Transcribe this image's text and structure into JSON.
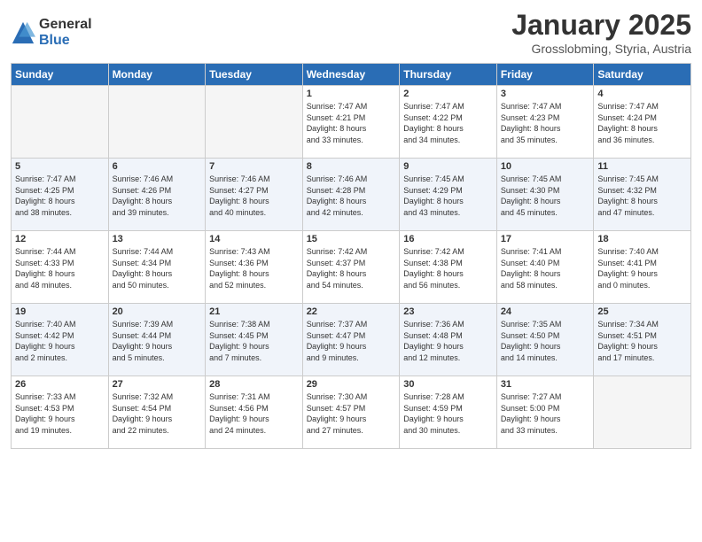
{
  "logo": {
    "general": "General",
    "blue": "Blue"
  },
  "title": "January 2025",
  "subtitle": "Grosslobming, Styria, Austria",
  "days": [
    "Sunday",
    "Monday",
    "Tuesday",
    "Wednesday",
    "Thursday",
    "Friday",
    "Saturday"
  ],
  "weeks": [
    [
      {
        "day": "",
        "content": ""
      },
      {
        "day": "",
        "content": ""
      },
      {
        "day": "",
        "content": ""
      },
      {
        "day": "1",
        "content": "Sunrise: 7:47 AM\nSunset: 4:21 PM\nDaylight: 8 hours\nand 33 minutes."
      },
      {
        "day": "2",
        "content": "Sunrise: 7:47 AM\nSunset: 4:22 PM\nDaylight: 8 hours\nand 34 minutes."
      },
      {
        "day": "3",
        "content": "Sunrise: 7:47 AM\nSunset: 4:23 PM\nDaylight: 8 hours\nand 35 minutes."
      },
      {
        "day": "4",
        "content": "Sunrise: 7:47 AM\nSunset: 4:24 PM\nDaylight: 8 hours\nand 36 minutes."
      }
    ],
    [
      {
        "day": "5",
        "content": "Sunrise: 7:47 AM\nSunset: 4:25 PM\nDaylight: 8 hours\nand 38 minutes."
      },
      {
        "day": "6",
        "content": "Sunrise: 7:46 AM\nSunset: 4:26 PM\nDaylight: 8 hours\nand 39 minutes."
      },
      {
        "day": "7",
        "content": "Sunrise: 7:46 AM\nSunset: 4:27 PM\nDaylight: 8 hours\nand 40 minutes."
      },
      {
        "day": "8",
        "content": "Sunrise: 7:46 AM\nSunset: 4:28 PM\nDaylight: 8 hours\nand 42 minutes."
      },
      {
        "day": "9",
        "content": "Sunrise: 7:45 AM\nSunset: 4:29 PM\nDaylight: 8 hours\nand 43 minutes."
      },
      {
        "day": "10",
        "content": "Sunrise: 7:45 AM\nSunset: 4:30 PM\nDaylight: 8 hours\nand 45 minutes."
      },
      {
        "day": "11",
        "content": "Sunrise: 7:45 AM\nSunset: 4:32 PM\nDaylight: 8 hours\nand 47 minutes."
      }
    ],
    [
      {
        "day": "12",
        "content": "Sunrise: 7:44 AM\nSunset: 4:33 PM\nDaylight: 8 hours\nand 48 minutes."
      },
      {
        "day": "13",
        "content": "Sunrise: 7:44 AM\nSunset: 4:34 PM\nDaylight: 8 hours\nand 50 minutes."
      },
      {
        "day": "14",
        "content": "Sunrise: 7:43 AM\nSunset: 4:36 PM\nDaylight: 8 hours\nand 52 minutes."
      },
      {
        "day": "15",
        "content": "Sunrise: 7:42 AM\nSunset: 4:37 PM\nDaylight: 8 hours\nand 54 minutes."
      },
      {
        "day": "16",
        "content": "Sunrise: 7:42 AM\nSunset: 4:38 PM\nDaylight: 8 hours\nand 56 minutes."
      },
      {
        "day": "17",
        "content": "Sunrise: 7:41 AM\nSunset: 4:40 PM\nDaylight: 8 hours\nand 58 minutes."
      },
      {
        "day": "18",
        "content": "Sunrise: 7:40 AM\nSunset: 4:41 PM\nDaylight: 9 hours\nand 0 minutes."
      }
    ],
    [
      {
        "day": "19",
        "content": "Sunrise: 7:40 AM\nSunset: 4:42 PM\nDaylight: 9 hours\nand 2 minutes."
      },
      {
        "day": "20",
        "content": "Sunrise: 7:39 AM\nSunset: 4:44 PM\nDaylight: 9 hours\nand 5 minutes."
      },
      {
        "day": "21",
        "content": "Sunrise: 7:38 AM\nSunset: 4:45 PM\nDaylight: 9 hours\nand 7 minutes."
      },
      {
        "day": "22",
        "content": "Sunrise: 7:37 AM\nSunset: 4:47 PM\nDaylight: 9 hours\nand 9 minutes."
      },
      {
        "day": "23",
        "content": "Sunrise: 7:36 AM\nSunset: 4:48 PM\nDaylight: 9 hours\nand 12 minutes."
      },
      {
        "day": "24",
        "content": "Sunrise: 7:35 AM\nSunset: 4:50 PM\nDaylight: 9 hours\nand 14 minutes."
      },
      {
        "day": "25",
        "content": "Sunrise: 7:34 AM\nSunset: 4:51 PM\nDaylight: 9 hours\nand 17 minutes."
      }
    ],
    [
      {
        "day": "26",
        "content": "Sunrise: 7:33 AM\nSunset: 4:53 PM\nDaylight: 9 hours\nand 19 minutes."
      },
      {
        "day": "27",
        "content": "Sunrise: 7:32 AM\nSunset: 4:54 PM\nDaylight: 9 hours\nand 22 minutes."
      },
      {
        "day": "28",
        "content": "Sunrise: 7:31 AM\nSunset: 4:56 PM\nDaylight: 9 hours\nand 24 minutes."
      },
      {
        "day": "29",
        "content": "Sunrise: 7:30 AM\nSunset: 4:57 PM\nDaylight: 9 hours\nand 27 minutes."
      },
      {
        "day": "30",
        "content": "Sunrise: 7:28 AM\nSunset: 4:59 PM\nDaylight: 9 hours\nand 30 minutes."
      },
      {
        "day": "31",
        "content": "Sunrise: 7:27 AM\nSunset: 5:00 PM\nDaylight: 9 hours\nand 33 minutes."
      },
      {
        "day": "",
        "content": ""
      }
    ]
  ]
}
